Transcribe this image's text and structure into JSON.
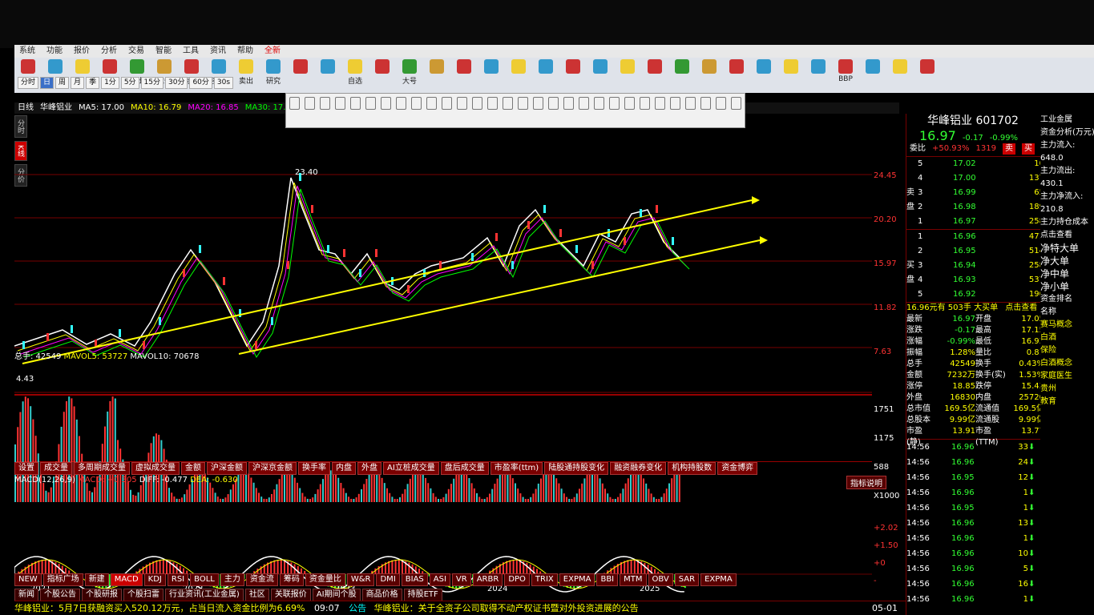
{
  "menu": {
    "items": [
      "系统",
      "功能",
      "报价",
      "分析",
      "交易",
      "智能",
      "工具",
      "资讯",
      "帮助",
      "全新"
    ],
    "highlight": "全新"
  },
  "toolbar": {
    "buttons": [
      "",
      "",
      "",
      "",
      "卖出",
      "竞价",
      "标注",
      "买入",
      "卖出",
      "研究",
      "",
      "",
      "自选",
      "",
      "大号",
      "",
      "",
      "",
      "",
      "",
      "",
      "",
      "",
      "",
      "",
      "",
      "",
      "",
      "",
      "",
      "BBP",
      "",
      "",
      ""
    ]
  },
  "periods": {
    "items": [
      "分时",
      "日",
      "周",
      "月",
      "季",
      "1分",
      "5分",
      "15分",
      "30分",
      "60分",
      "30s"
    ],
    "selected": "日"
  },
  "ma_header": {
    "period": "日线",
    "name": "华峰铝业",
    "ma5": "MA5: 17.00",
    "ma10": "MA10: 16.79",
    "ma20": "MA20: 16.85",
    "ma30": "MA30: 17.77"
  },
  "left_tabs": [
    "分时",
    "K线",
    "分价"
  ],
  "kline": {
    "high_label": "23.40",
    "low_label": "4.43",
    "axis": [
      "24.45",
      "20.20",
      "15.97",
      "11.82",
      "7.63"
    ],
    "year_labels": [
      "2021",
      "2022",
      "2023",
      "2024",
      "2025"
    ]
  },
  "volume": {
    "zongshou": "总手: 42549",
    "mavol5": "MAVOL5: 53727",
    "mavol10": "MAVOL10: 70678",
    "axis": [
      "1751",
      "1175",
      "588",
      "X1000"
    ]
  },
  "ind_tabs": [
    "设置",
    "成交量",
    "多周期成交量",
    "虚拟成交量",
    "金额",
    "沪深金额",
    "沪深京金额",
    "换手率",
    "内盘",
    "外盘",
    "AI立桩成交量",
    "盘后成交量",
    "市盈率(ttm)",
    "陆股通持股变化",
    "融资融券变化",
    "机构持股数",
    "资金博弈"
  ],
  "macd": {
    "title": "MACD(12,26,9)",
    "macd": "MACD: +0.305",
    "diff": "DIFF: -0.477",
    "dea": "DEA: -0.630",
    "button": "指标说明",
    "axis": [
      "+2.02",
      "+1.50",
      "+0",
      "-"
    ]
  },
  "ind_tabs2": [
    "NEW",
    "指标广场",
    "新建",
    "MACD",
    "KDJ",
    "RSI",
    "BOLL",
    "主力",
    "资金流",
    "筹码",
    "资金量比",
    "W&R",
    "DMI",
    "BIAS",
    "ASI",
    "VR",
    "ARBR",
    "DPO",
    "TRIX",
    "EXPMA",
    "BBI",
    "MTM",
    "OBV",
    "SAR",
    "EXPMA"
  ],
  "ind_tabs3": [
    "新闻",
    "个股公告",
    "个股研报",
    "个股扫雷",
    "行业资讯(工业金属)",
    "社区",
    "关联报价",
    "AI期间个股",
    "商品价格",
    "持股ETF"
  ],
  "news": {
    "left": "华峰铝业：5月7日获融资买入520.12万元，占当日流入资金比例为6.69%",
    "mid": "公告",
    "right": "华峰铝业：关于全资子公司取得不动产权证书暨对外投资进展的公告",
    "date": "05-01",
    "time": "09:07"
  },
  "quote": {
    "name": "华峰铝业",
    "code": "601702",
    "price": "16.97",
    "change": "-0.17",
    "pct": "-0.99%",
    "weibi": "委比",
    "weibi_val": "+50.93%",
    "weicha": "1319",
    "sell": [
      {
        "l": "5",
        "p": "17.02",
        "v": "10"
      },
      {
        "l": "4",
        "p": "17.00",
        "v": "137"
      },
      {
        "l": "3",
        "p": "16.99",
        "v": "65"
      },
      {
        "l": "2",
        "p": "16.98",
        "v": "189"
      },
      {
        "l": "1",
        "p": "16.97",
        "v": "258"
      }
    ],
    "buy": [
      {
        "l": "1",
        "p": "16.96",
        "v": "471"
      },
      {
        "l": "2",
        "p": "16.95",
        "v": "514"
      },
      {
        "l": "3",
        "p": "16.94",
        "v": "258"
      },
      {
        "l": "4",
        "p": "16.93",
        "v": "537"
      },
      {
        "l": "5",
        "p": "16.92",
        "v": "190"
      }
    ],
    "sell_label": "卖盘",
    "buy_label": "买盘",
    "big_order": "16.96元有 503手 大买单",
    "big_order_link": "点击查看"
  },
  "stats": [
    {
      "a": "最新",
      "b": "16.97",
      "c": "开盘",
      "d": "17.05"
    },
    {
      "a": "涨跌",
      "b": "-0.17",
      "c": "最高",
      "d": "17.15"
    },
    {
      "a": "涨幅",
      "b": "-0.99%",
      "c": "最低",
      "d": "16.93"
    },
    {
      "a": "振幅",
      "b": "1.28%",
      "c": "量比",
      "d": "0.81"
    },
    {
      "a": "总手",
      "b": "42549",
      "c": "换手",
      "d": "0.43%"
    },
    {
      "a": "金额",
      "b": "7232万",
      "c": "换手(实)",
      "d": "1.53%"
    },
    {
      "a": "涨停",
      "b": "18.85",
      "c": "跌停",
      "d": "15.43"
    },
    {
      "a": "外盘",
      "b": "16830",
      "c": "内盘",
      "d": "25720"
    },
    {
      "a": "总市值",
      "b": "169.5亿",
      "c": "流通值",
      "d": "169.5亿"
    },
    {
      "a": "总股本",
      "b": "9.99亿",
      "c": "流通股",
      "d": "9.99亿"
    },
    {
      "a": "市盈(静)",
      "b": "13.91",
      "c": "市盈(TTM)",
      "d": "13.77"
    }
  ],
  "ticks": [
    {
      "t": "14:56",
      "p": "16.96",
      "v": "33",
      "arrow": "⬇"
    },
    {
      "t": "14:56",
      "p": "16.96",
      "v": "24",
      "arrow": "⬇"
    },
    {
      "t": "14:56",
      "p": "16.95",
      "v": "12",
      "arrow": "⬇"
    },
    {
      "t": "14:56",
      "p": "16.96",
      "v": "1",
      "arrow": "⬇"
    },
    {
      "t": "14:56",
      "p": "16.95",
      "v": "1",
      "arrow": "⬇"
    },
    {
      "t": "14:56",
      "p": "16.96",
      "v": "13",
      "arrow": "⬇"
    },
    {
      "t": "14:56",
      "p": "16.96",
      "v": "1",
      "arrow": "⬇"
    },
    {
      "t": "14:56",
      "p": "16.96",
      "v": "10",
      "arrow": "⬇"
    },
    {
      "t": "14:56",
      "p": "16.96",
      "v": "5",
      "arrow": "⬇"
    },
    {
      "t": "14:56",
      "p": "16.96",
      "v": "16",
      "arrow": "⬇"
    },
    {
      "t": "14:56",
      "p": "16.96",
      "v": "1",
      "arrow": "⬇"
    }
  ],
  "far_panel": {
    "items": [
      "工业金属",
      "资金分析(万元)",
      "主力流入:",
      "648.0",
      "主力流出:",
      "430.1",
      "主力净流入:",
      "210.8",
      "主力持仓成本",
      "点击查看",
      "净特大单",
      "净大单",
      "净中单",
      "净小单",
      "资金排名",
      "名称",
      "赛马概念",
      "白酒",
      "保险",
      "白酒概念",
      "家庭医生",
      "贵州",
      "教育"
    ]
  }
}
